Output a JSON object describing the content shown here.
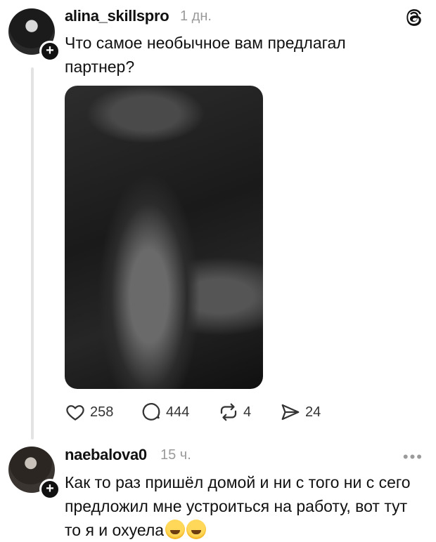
{
  "post": {
    "username": "alina_skillspro",
    "time": "1 дн.",
    "text": "Что самое необычное вам предлагал партнер?",
    "likes": "258",
    "comments": "444",
    "reposts": "4",
    "shares": "24"
  },
  "reply": {
    "username": "naebalova0",
    "time": "15 ч.",
    "text": "Как то раз пришёл домой и ни с того ни с сего предложил мне устроиться на работу, вот тут то я и охуела"
  },
  "icons": {
    "app": "threads-icon",
    "like": "heart-icon",
    "comment": "comment-icon",
    "repost": "repost-icon",
    "share": "send-icon",
    "more": "more-icon"
  }
}
